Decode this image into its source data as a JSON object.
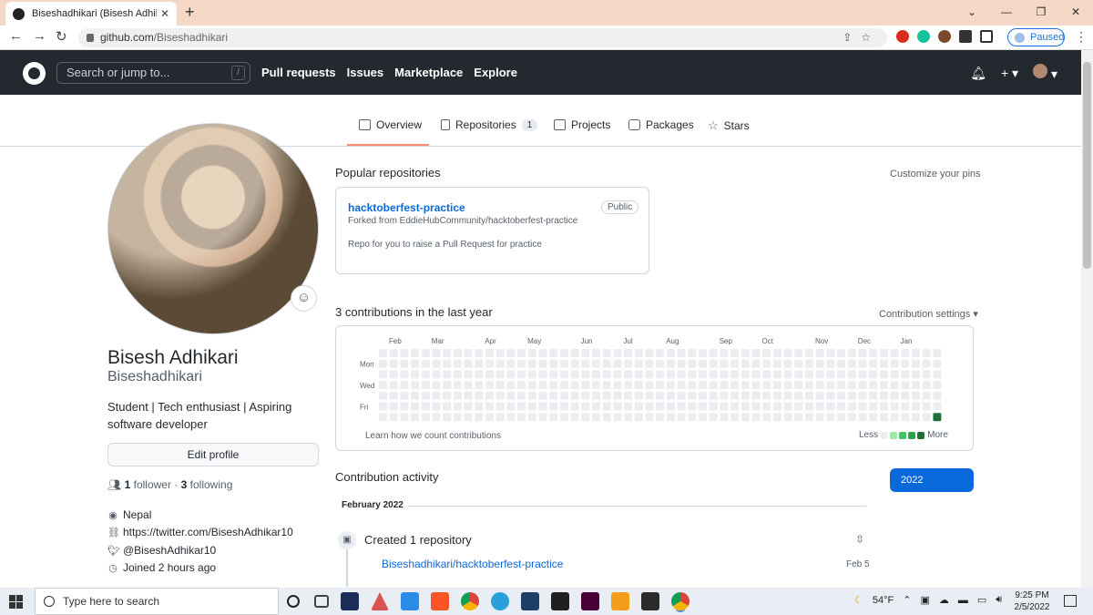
{
  "browser": {
    "tab_title": "Biseshadhikari (Bisesh Adhikari)",
    "tab_close": "✕",
    "new_tab": "+",
    "url_host": "github.com",
    "url_path": "/Biseshadhikari",
    "profile_status": "Paused",
    "window_controls": [
      "⌄",
      "—",
      "❐",
      "✕"
    ]
  },
  "github_header": {
    "search_placeholder": "Search or jump to...",
    "search_shortcut": "/",
    "nav": [
      "Pull requests",
      "Issues",
      "Marketplace",
      "Explore"
    ]
  },
  "profile_tabs": [
    {
      "label": "Overview",
      "count": null
    },
    {
      "label": "Repositories",
      "count": "1"
    },
    {
      "label": "Projects",
      "count": null
    },
    {
      "label": "Packages",
      "count": null
    },
    {
      "label": "Stars",
      "count": null
    }
  ],
  "profile": {
    "full_name": "Bisesh Adhikari",
    "username": "Biseshadhikari",
    "bio": "Student | Tech enthusiast | Aspiring software developer",
    "edit_button": "Edit profile",
    "followers_count": "1",
    "followers_label": "follower",
    "following_count": "3",
    "following_label": "following",
    "location": "Nepal",
    "website": "https://twitter.com/BiseshAdhikar10",
    "twitter": "@BiseshAdhikar10",
    "joined": "Joined 2 hours ago"
  },
  "popular": {
    "title": "Popular repositories",
    "customize": "Customize your pins",
    "repo": {
      "name": "hacktoberfest-practice",
      "visibility": "Public",
      "forked_from": "Forked from EddieHubCommunity/hacktoberfest-practice",
      "description": "Repo for you to raise a Pull Request for practice"
    }
  },
  "contributions": {
    "title": "3 contributions in the last year",
    "settings": "Contribution settings ▾",
    "months": [
      "Feb",
      "Mar",
      "Apr",
      "May",
      "Jun",
      "Jul",
      "Aug",
      "Sep",
      "Oct",
      "Nov",
      "Dec",
      "Jan"
    ],
    "day_labels": [
      "Mon",
      "Wed",
      "Fri"
    ],
    "learn_link": "Learn how we count contributions",
    "legend_less": "Less",
    "legend_more": "More",
    "legend_colors": [
      "#ebedf0",
      "#9be9a8",
      "#40c463",
      "#30a14e",
      "#216e39"
    ],
    "empty_color": "#ebedf0",
    "active_color": "#216e39",
    "active_cell": {
      "week": 52,
      "day": 6
    }
  },
  "activity": {
    "title": "Contribution activity",
    "year": "2022",
    "month": "February 2022",
    "event": "Created 1 repository",
    "repo_link": "Biseshadhikari/hacktoberfest-practice",
    "date": "Feb 5"
  },
  "taskbar": {
    "search_placeholder": "Type here to search",
    "weather": "54°F",
    "time": "9:25 PM",
    "date": "2/5/2022"
  }
}
